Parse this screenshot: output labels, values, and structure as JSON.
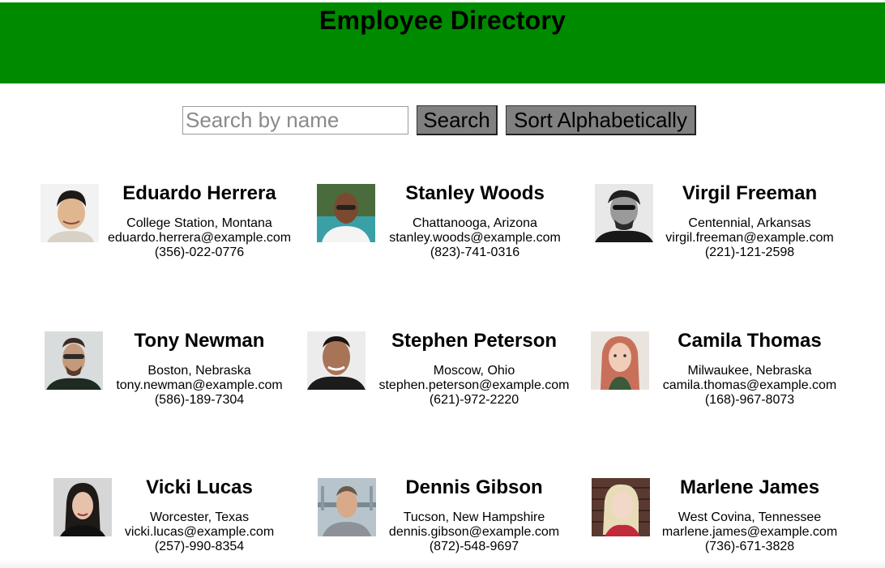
{
  "header": {
    "title": "Employee Directory",
    "bg_color": "#008a00"
  },
  "controls": {
    "search_placeholder": "Search by name",
    "search_value": "",
    "search_button": "Search",
    "sort_button": "Sort Alphabetically",
    "button_color": "#808080"
  },
  "employees": [
    {
      "name": "Eduardo Herrera",
      "location": "College Station, Montana",
      "email": "eduardo.herrera@example.com",
      "phone": "(356)-022-0776",
      "photo": "portrait-man-smiling"
    },
    {
      "name": "Stanley Woods",
      "location": "Chattanooga, Arizona",
      "email": "stanley.woods@example.com",
      "phone": "(823)-741-0316",
      "photo": "portrait-man-glasses-pool"
    },
    {
      "name": "Virgil Freeman",
      "location": "Centennial, Arkansas",
      "email": "virgil.freeman@example.com",
      "phone": "(221)-121-2598",
      "photo": "portrait-man-bw-glasses"
    },
    {
      "name": "Tony Newman",
      "location": "Boston, Nebraska",
      "email": "tony.newman@example.com",
      "phone": "(586)-189-7304",
      "photo": "portrait-man-sunglasses-beard"
    },
    {
      "name": "Stephen Peterson",
      "location": "Moscow, Ohio",
      "email": "stephen.peterson@example.com",
      "phone": "(621)-972-2220",
      "photo": "portrait-man-smiling-dark"
    },
    {
      "name": "Camila Thomas",
      "location": "Milwaukee, Nebraska",
      "email": "camila.thomas@example.com",
      "phone": "(168)-967-8073",
      "photo": "portrait-woman-long-hair"
    },
    {
      "name": "Vicki Lucas",
      "location": "Worcester, Texas",
      "email": "vicki.lucas@example.com",
      "phone": "(257)-990-8354",
      "photo": "portrait-woman-dark-hair"
    },
    {
      "name": "Dennis Gibson",
      "location": "Tucson, New Hampshire",
      "email": "dennis.gibson@example.com",
      "phone": "(872)-548-9697",
      "photo": "portrait-man-pier"
    },
    {
      "name": "Marlene James",
      "location": "West Covina, Tennessee",
      "email": "marlene.james@example.com",
      "phone": "(736)-671-3828",
      "photo": "portrait-woman-blonde-brick"
    }
  ]
}
